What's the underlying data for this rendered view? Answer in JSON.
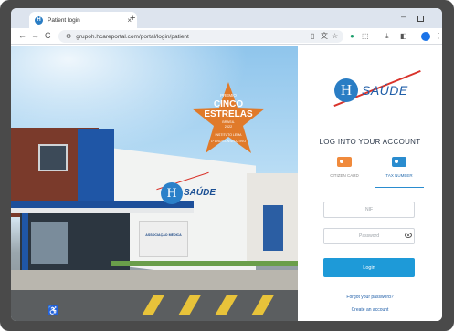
{
  "browser": {
    "tab_title": "Patient login",
    "tab_favicon": "H",
    "tab_close": "×",
    "new_tab": "+",
    "minimize": "–",
    "url": "grupoh.hcareportal.com/portal/login/patient",
    "nav": {
      "back": "←",
      "forward": "→",
      "reload": "C"
    },
    "toolbar_icons": [
      "read-aloud-icon",
      "translate-icon",
      "bookmark-star-icon",
      "extension-icon",
      "puzzle-icon",
      "download-icon",
      "sidebar-icon",
      "profile-icon",
      "menu-icon"
    ]
  },
  "hero": {
    "award": {
      "label": "PREMIO",
      "line1": "CINCO",
      "line2": "ESTRELAS",
      "country": "BRASIL",
      "year": "2022",
      "institute": "INSTITUTO LEMA",
      "place": "1º ANO CONSECUTIVO"
    },
    "building_logo_letter": "H",
    "building_logo_word": "SAÚDE",
    "entrance_sign": "ASSOCIAÇÃO MÉDICA"
  },
  "login": {
    "brand_letter": "H",
    "brand_word": "SAÚDE",
    "title": "LOG INTO YOUR ACCOUNT",
    "id_tabs": [
      {
        "label": "CITIZEN CARD",
        "selected": false
      },
      {
        "label": "TAX NUMBER",
        "selected": true
      }
    ],
    "nif_placeholder": "NIF",
    "password_placeholder": "Password",
    "login_button": "Login",
    "forgot_password": "Forgot your password?",
    "create_account": "Create an account"
  },
  "colors": {
    "brand_blue": "#1f5ea8",
    "button_blue": "#1e9ad8",
    "accent_red": "#d9332b",
    "award_orange": "#e07a2a"
  }
}
